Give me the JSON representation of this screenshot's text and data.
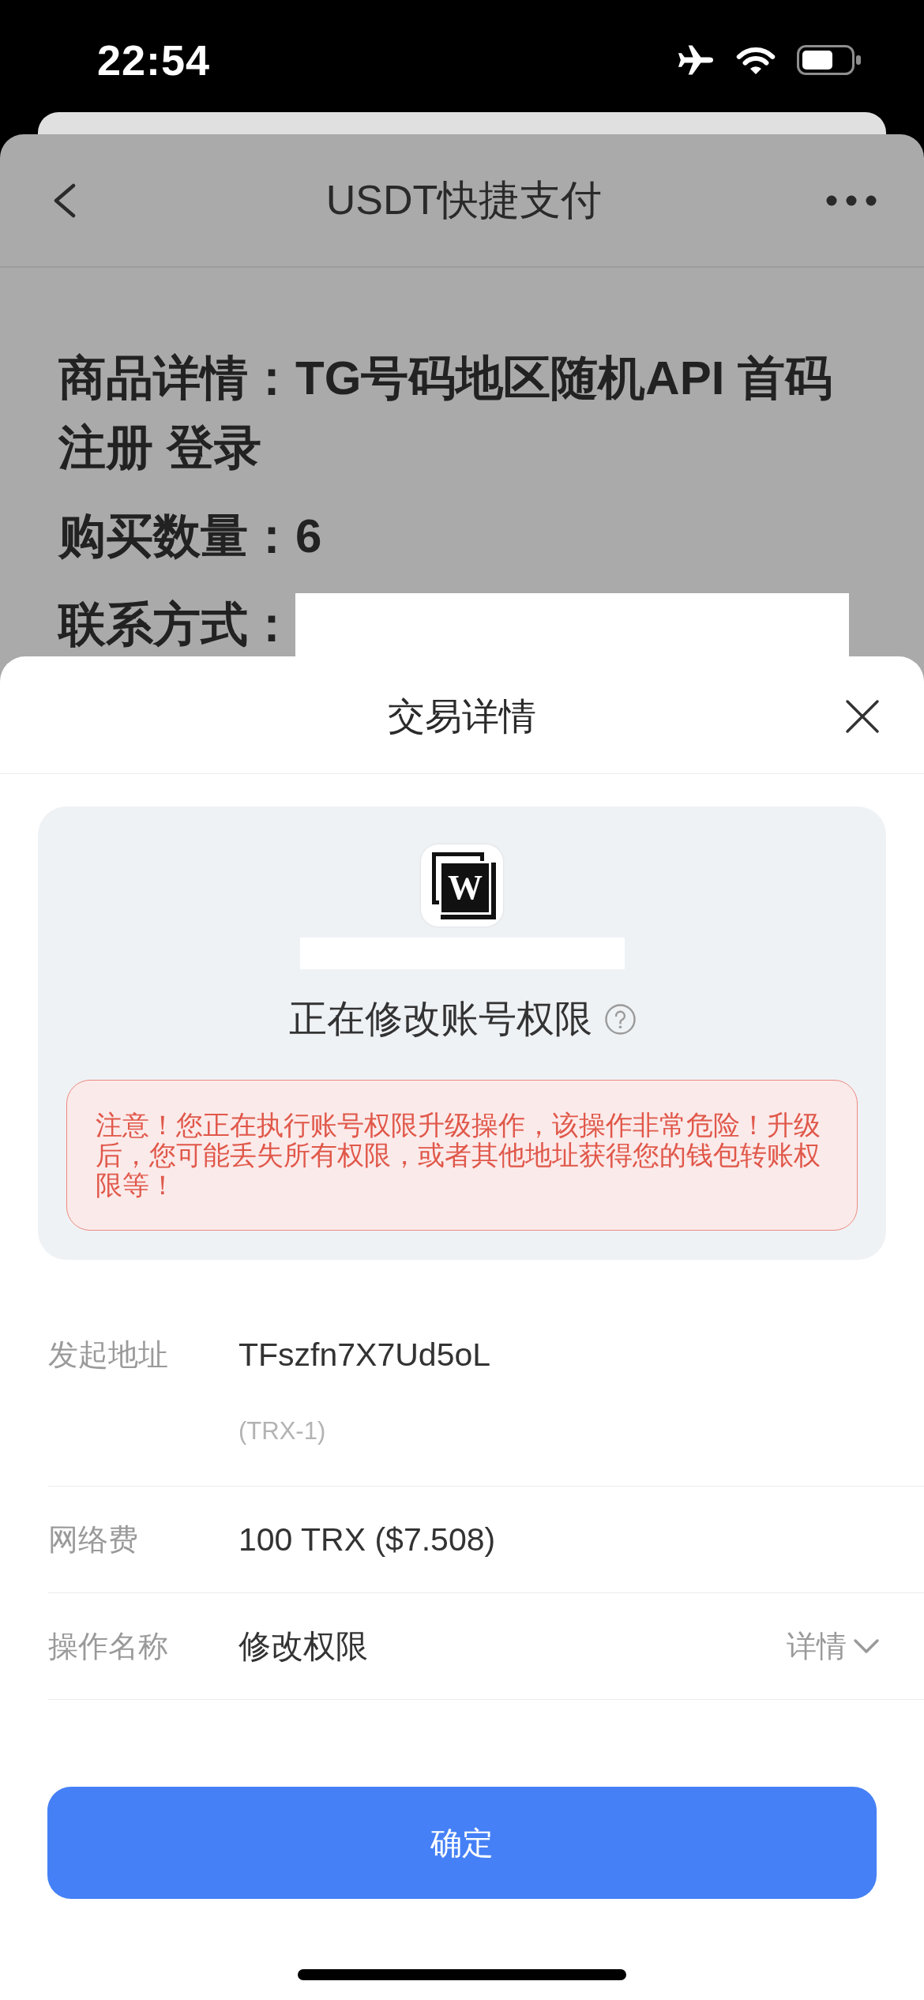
{
  "status_bar": {
    "time": "22:54"
  },
  "page": {
    "title": "USDT快捷支付",
    "details": [
      {
        "text": "商品详情：TG号码地区随机API 首码注册 登录",
        "redacted": false
      },
      {
        "text": "购买数量：6",
        "redacted": false
      },
      {
        "text": "联系方式：",
        "redacted": true
      }
    ]
  },
  "sheet": {
    "title": "交易详情",
    "summary": {
      "logo_text": "W",
      "name_redacted": true,
      "action": "正在修改账号权限",
      "warning": "注意！您正在执行账号权限升级操作，该操作非常危险！升级后，您可能丢失所有权限，或者其他地址获得您的钱包转账权限等！"
    },
    "rows": [
      {
        "label": "发起地址",
        "value": "TFszfn7X7Ud5oL",
        "note": "(TRX-1)"
      },
      {
        "label": "网络费",
        "value": "100 TRX ($7.508)"
      },
      {
        "label": "操作名称",
        "value": "修改权限",
        "link": "详情",
        "expanded": false
      }
    ],
    "confirm_button": "确定"
  }
}
